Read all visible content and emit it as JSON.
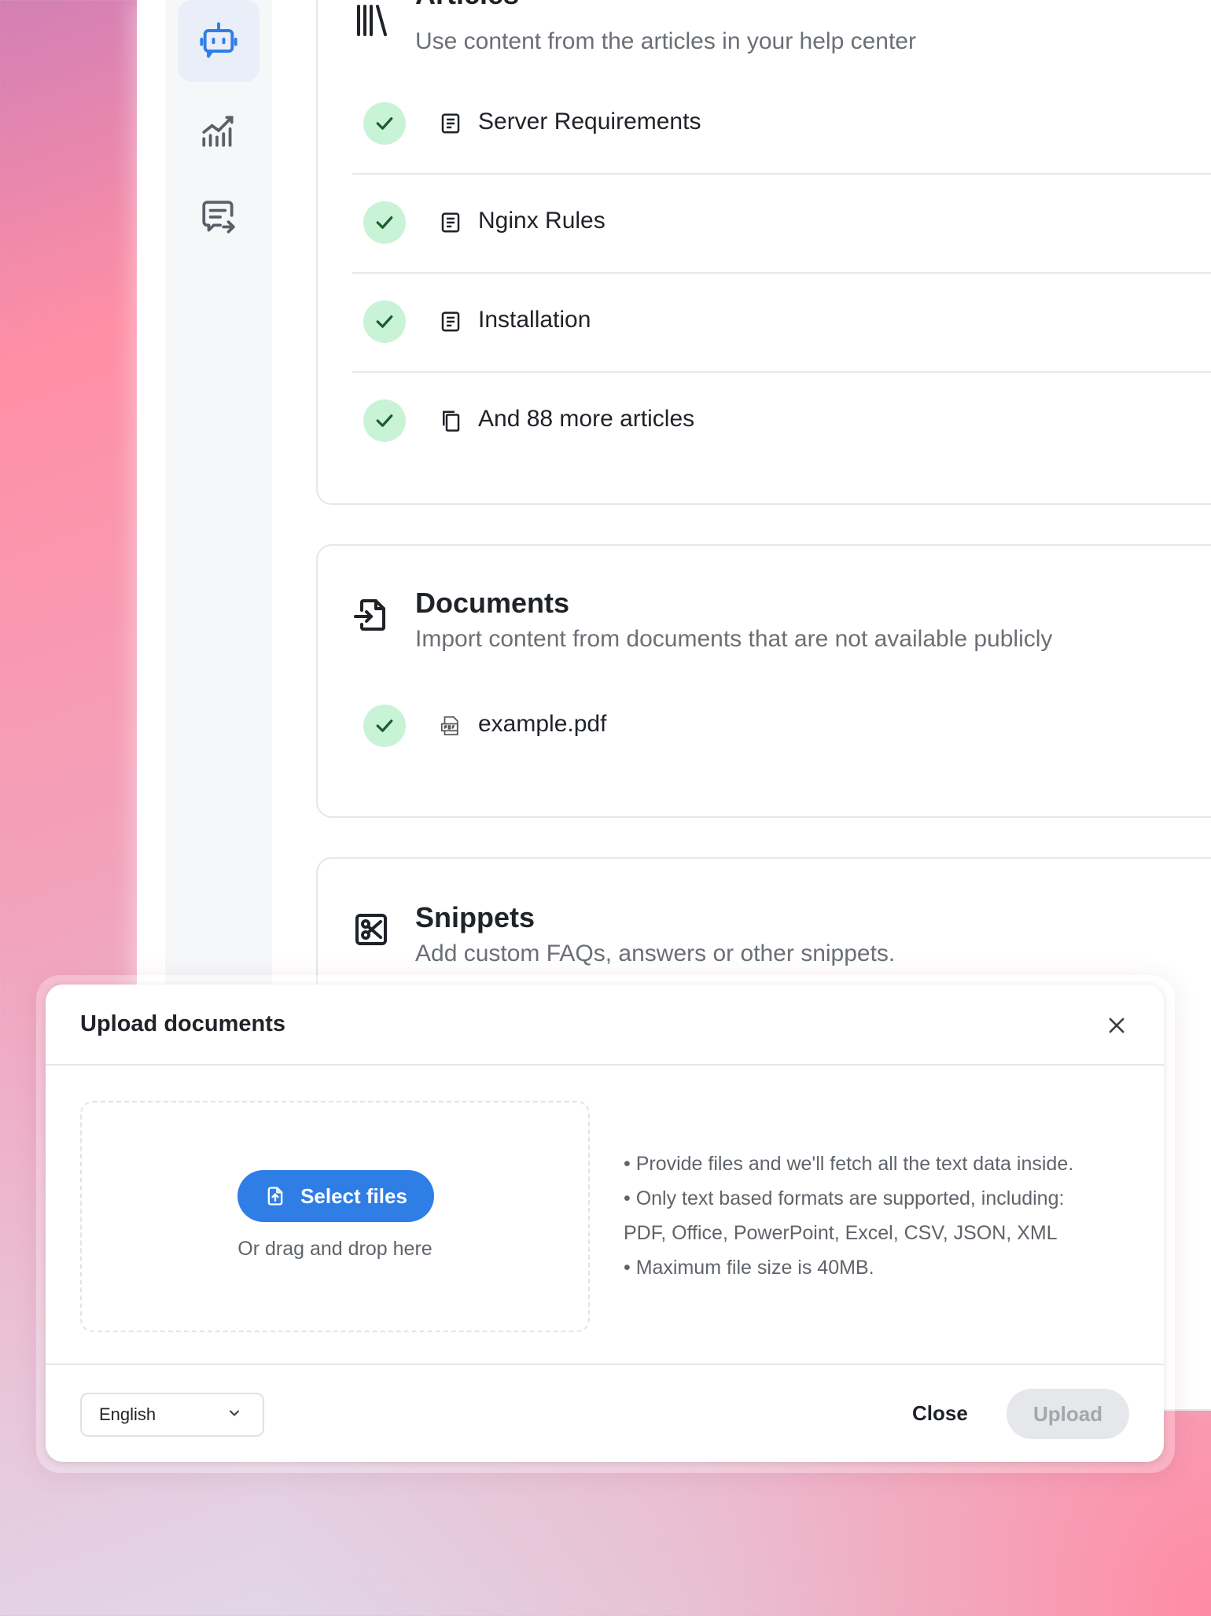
{
  "articles": {
    "title": "Articles",
    "subtitle": "Use content from the articles in your help center",
    "items": [
      {
        "label": "Server Requirements",
        "icon": "article-icon"
      },
      {
        "label": "Nginx Rules",
        "icon": "article-icon"
      },
      {
        "label": "Installation",
        "icon": "article-icon"
      },
      {
        "label": "And 88 more articles",
        "icon": "copy-icon"
      }
    ]
  },
  "documents": {
    "title": "Documents",
    "subtitle": "Import content from documents that are not available publicly",
    "items": [
      {
        "label": "example.pdf",
        "icon": "pdf-file-icon"
      }
    ]
  },
  "snippets": {
    "title": "Snippets",
    "subtitle": "Add custom FAQs, answers or other snippets."
  },
  "dialog": {
    "title": "Upload documents",
    "select_button": "Select files",
    "drag_text": "Or drag and drop here",
    "info": [
      "• Provide files and we'll fetch all the text data inside.",
      "• Only text based formats are supported, including:",
      "PDF, Office, PowerPoint, Excel, CSV, JSON, XML",
      "• Maximum file size is 40MB."
    ],
    "language": "English",
    "close_label": "Close",
    "upload_label": "Upload"
  },
  "colors": {
    "accent": "#2f7ee6",
    "check_bg": "#c9f3d6",
    "check_mark": "#1b5e2b"
  }
}
